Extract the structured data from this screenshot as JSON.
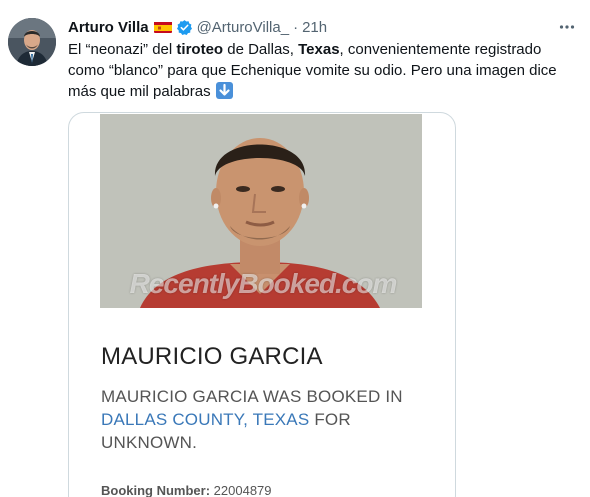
{
  "tweet": {
    "author_name": "Arturo Villa",
    "flag_icon": "spain-flag-icon",
    "verified_icon": "verified-badge-icon",
    "handle": "@ArturoVilla_",
    "separator": "·",
    "time": "21h",
    "more_icon": "more-options-icon",
    "text": {
      "p1": "El “neonazi” del ",
      "b1": "tiroteo",
      "p2": " de Dallas, ",
      "b2": "Texas",
      "p3": ", convenientemente registrado como “blanco” para que Echenique vomite su odio. Pero una imagen dice más que mil palabras ",
      "emoji": "down-arrow-emoji"
    }
  },
  "card": {
    "watermark": "RecentlyBooked.com",
    "person_name": "MAURICIO GARCIA",
    "desc_p1": "MAURICIO GARCIA WAS BOOKED IN ",
    "desc_link": "DALLAS COUNTY, TEXAS",
    "desc_p2": " FOR UNKNOWN.",
    "booking_label": "Booking Number:",
    "booking_value": " 22004879"
  },
  "colors": {
    "text": "#0f1419",
    "secondary": "#536471",
    "verified": "#1d9bf0",
    "link": "#3a78b8",
    "border": "#cfd9de"
  }
}
